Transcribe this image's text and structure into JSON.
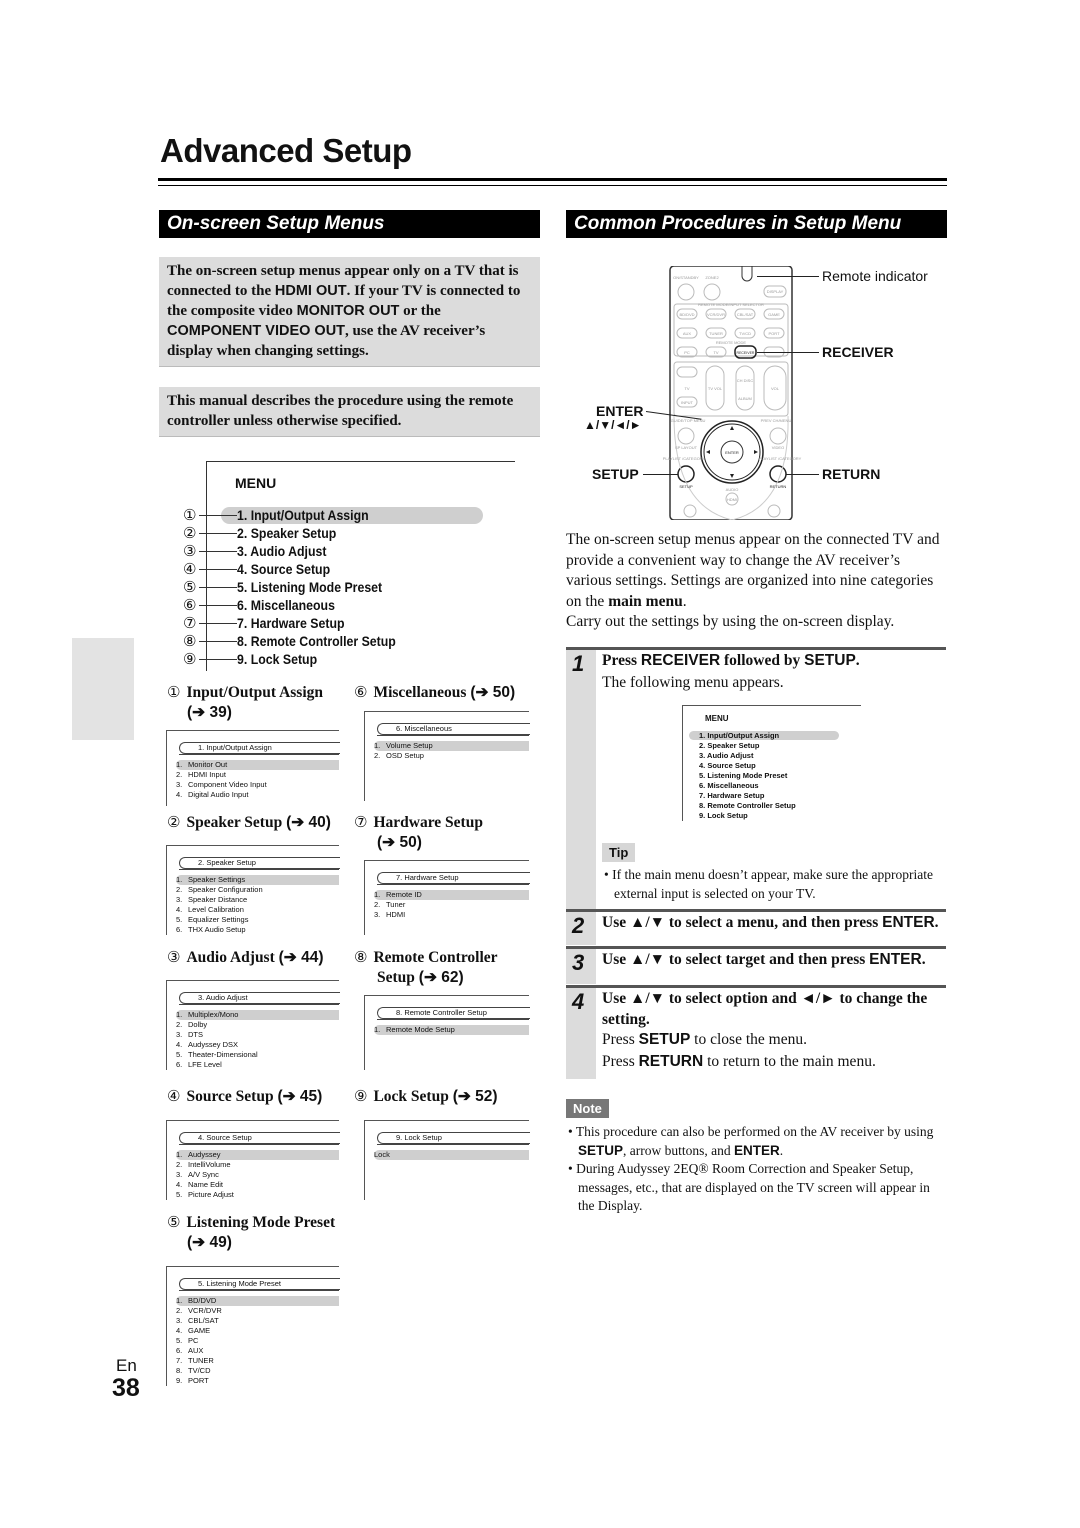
{
  "page": {
    "title": "Advanced Setup",
    "lang": "En",
    "number": "38"
  },
  "left": {
    "heading": "On-screen Setup Menus",
    "notice1": {
      "t1": "The on-screen setup menus appear only on a TV that is connected to the ",
      "k1": "HDMI OUT",
      "t2": ". If your TV is connected to the composite video ",
      "k2": "MONITOR OUT",
      "t3": " or the ",
      "k3": "COMPONENT VIDEO OUT",
      "t4": ", use the AV receiver’s display when changing settings."
    },
    "notice2": "This manual describes the procedure using the remote controller unless otherwise specified.",
    "menu": {
      "title": "MENU",
      "callouts": [
        "①",
        "②",
        "③",
        "④",
        "⑤",
        "⑥",
        "⑦",
        "⑧",
        "⑨"
      ],
      "items": [
        "1. Input/Output Assign",
        "2. Speaker Setup",
        "3. Audio Adjust",
        "4. Source Setup",
        "5. Listening Mode Preset",
        "6. Miscellaneous",
        "7. Hardware Setup",
        "8. Remote Controller Setup",
        "9. Lock Setup"
      ]
    },
    "submenus": [
      {
        "num": "①",
        "title": "Input/Output Assign",
        "ref": "(➔ 39)",
        "box_title": "1.   Input/Output Assign",
        "items": [
          [
            "1.",
            "Monitor Out"
          ],
          [
            "2.",
            "HDMI Input"
          ],
          [
            "3.",
            "Component Video Input"
          ],
          [
            "4.",
            "Digital Audio Input"
          ]
        ]
      },
      {
        "num": "②",
        "title": "Speaker Setup",
        "ref": "(➔ 40)",
        "box_title": "2.   Speaker Setup",
        "items": [
          [
            "1.",
            "Speaker Settings"
          ],
          [
            "2.",
            "Speaker Configuration"
          ],
          [
            "3.",
            "Speaker Distance"
          ],
          [
            "4.",
            "Level Calibration"
          ],
          [
            "5.",
            "Equalizer Settings"
          ],
          [
            "6.",
            "THX Audio Setup"
          ]
        ]
      },
      {
        "num": "③",
        "title": "Audio Adjust",
        "ref": "(➔ 44)",
        "box_title": "3.   Audio Adjust",
        "items": [
          [
            "1.",
            "Multiplex/Mono"
          ],
          [
            "2.",
            "Dolby"
          ],
          [
            "3.",
            "DTS"
          ],
          [
            "4.",
            "Audyssey DSX"
          ],
          [
            "5.",
            "Theater-Dimensional"
          ],
          [
            "6.",
            "LFE Level"
          ]
        ]
      },
      {
        "num": "④",
        "title": "Source Setup",
        "ref": "(➔ 45)",
        "box_title": "4.   Source Setup",
        "items": [
          [
            "1.",
            "Audyssey"
          ],
          [
            "2.",
            "IntelliVolume"
          ],
          [
            "3.",
            "A/V Sync"
          ],
          [
            "4.",
            "Name Edit"
          ],
          [
            "5.",
            "Picture Adjust"
          ]
        ]
      },
      {
        "num": "⑤",
        "title": "Listening Mode Preset",
        "ref": "(➔ 49)",
        "box_title": "5.   Listening Mode Preset",
        "items": [
          [
            "1.",
            "BD/DVD"
          ],
          [
            "2.",
            "VCR/DVR"
          ],
          [
            "3.",
            "CBL/SAT"
          ],
          [
            "4.",
            "GAME"
          ],
          [
            "5.",
            "PC"
          ],
          [
            "6.",
            "AUX"
          ],
          [
            "7.",
            "TUNER"
          ],
          [
            "8.",
            "TV/CD"
          ],
          [
            "9.",
            "PORT"
          ]
        ]
      },
      {
        "num": "⑥",
        "title": "Miscellaneous",
        "ref": "(➔ 50)",
        "box_title": "6.   Miscellaneous",
        "items": [
          [
            "1.",
            "Volume Setup"
          ],
          [
            "2.",
            "OSD Setup"
          ]
        ]
      },
      {
        "num": "⑦",
        "title": "Hardware Setup",
        "ref": "(➔ 50)",
        "box_title": "7.   Hardware Setup",
        "items": [
          [
            "1.",
            "Remote ID"
          ],
          [
            "2.",
            "Tuner"
          ],
          [
            "3.",
            "HDMI"
          ]
        ]
      },
      {
        "num": "⑧",
        "title": "Remote Controller Setup",
        "title_a": "Remote Controller",
        "title_b": "Setup",
        "ref": "(➔ 62)",
        "box_title": "8.   Remote Controller Setup",
        "items": [
          [
            "1.",
            "Remote Mode Setup"
          ]
        ]
      },
      {
        "num": "⑨",
        "title": "Lock Setup",
        "ref": "(➔ 52)",
        "box_title": "9.   Lock Setup",
        "items": [
          [
            "",
            "Lock"
          ]
        ]
      }
    ]
  },
  "right": {
    "heading": "Common Procedures in Setup Menu",
    "remote": {
      "labels": {
        "indicator": "Remote indicator",
        "receiver": "RECEIVER",
        "enter": "ENTER",
        "arrows": "▲/▼/◄/►",
        "setup": "SETUP",
        "return": "RETURN"
      },
      "keys": {
        "on_standby": "ON/STANDBY",
        "zone2": "ZONE2",
        "display": "DISPLAY",
        "mode_selector": "REMOTE MODE/INPUT SELECTOR",
        "bd_dvd": "BD/DVD",
        "vcr_dvr": "VCR/DVR",
        "cbl_sat": "CBL/SAT",
        "game": "GAME",
        "aux": "AUX",
        "tuner": "TUNER",
        "tv_cd": "TV/CD",
        "port": "PORT",
        "remote_mode": "REMOTE MODE",
        "pc": "PC",
        "tv": "TV",
        "receiver": "RECEIVER",
        "tv_label": "TV",
        "input": "INPUT",
        "tv_vol": "TV VOL",
        "ch_disc": "CH DISC",
        "album": "ALBUM",
        "vol": "VOL",
        "guide": "GUIDE/TOP MENU",
        "prev_ch": "PREV CH/MENU",
        "sp_layout": "SP LAYOUT",
        "video": "VIDEO",
        "playlist_l": "PLAYLIST /CATEGORY",
        "playlist_r": "PLAYLIST /CATEGORY",
        "enter": "ENTER",
        "setup": "SETUP",
        "return": "RETURN",
        "audio": "AUDIO",
        "hdmi": "HDMI"
      }
    },
    "intro": {
      "p1a": "The on-screen setup menus appear on the connected TV and provide a convenient way to change the AV receiver’s various settings. Settings are organized into nine categories on the ",
      "p1b": "main menu",
      "p1c": ".",
      "p2": "Carry out the settings by using the on-screen display."
    },
    "steps": [
      {
        "num": "1",
        "h_a": "Press ",
        "h_k1": "RECEIVER",
        "h_b": " followed by ",
        "h_k2": "SETUP",
        "h_c": ".",
        "body": "The following menu appears."
      },
      {
        "num": "2",
        "h_a": "Use ▲/▼ to select a menu, and then press ",
        "h_k1": "ENTER",
        "h_c": "."
      },
      {
        "num": "3",
        "h_a": "Use ▲/▼ to select target and then press ",
        "h_k1": "ENTER",
        "h_c": "."
      },
      {
        "num": "4",
        "h_a": "Use ▲/▼ to select option and ◄/► to change the setting.",
        "l1a": "Press ",
        "l1k": "SETUP",
        "l1b": " to close the menu.",
        "l2a": "Press ",
        "l2k": "RETURN",
        "l2b": " to return to the main menu."
      }
    ],
    "small_menu": {
      "title": "MENU",
      "items": [
        "1. Input/Output Assign",
        "2. Speaker Setup",
        "3. Audio Adjust",
        "4. Source Setup",
        "5. Listening Mode Preset",
        "6. Miscellaneous",
        "7. Hardware Setup",
        "8. Remote Controller Setup",
        "9. Lock Setup"
      ]
    },
    "tip": {
      "label": "Tip",
      "text": "If the main menu doesn’t appear, make sure the appropriate external input is selected on your TV."
    },
    "note": {
      "label": "Note",
      "b1a": "This procedure can also be performed on the AV receiver by using ",
      "b1k1": "SETUP",
      "b1b": ", arrow buttons, and ",
      "b1k2": "ENTER",
      "b1c": ".",
      "b2": "During Audyssey 2EQ® Room Correction and Speaker Setup, messages, etc., that are displayed on the TV screen will appear in the Display."
    }
  }
}
